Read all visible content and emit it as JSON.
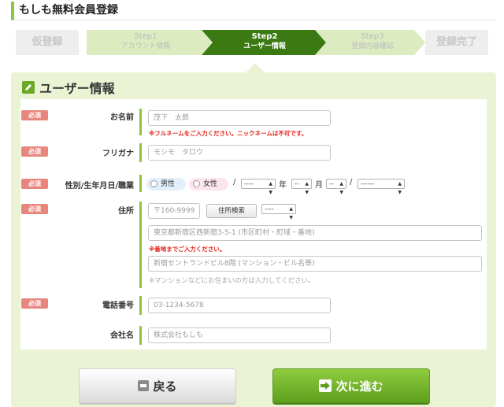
{
  "page_title": "もしも無料会員登録",
  "steps": {
    "first": "仮登録",
    "step1": {
      "num": "Step1",
      "label": "アカウント情報"
    },
    "step2": {
      "num": "Step2",
      "label": "ユーザー情報"
    },
    "step3": {
      "num": "Step3",
      "label": "登録内容確認"
    },
    "last": "登録完了",
    "active_color": "#3b7a12",
    "inactive_color": "#dcebc0"
  },
  "section_title": "ユーザー情報",
  "required_label": "必須",
  "form": {
    "name": {
      "label": "お名前",
      "placeholder": "茂下　太郎",
      "error": "※フルネームをご入力ください。ニックネームは不可です。"
    },
    "furigana": {
      "label": "フリガナ",
      "placeholder": "モシモ　タロウ"
    },
    "profile": {
      "label": "性別/生年月日/職業",
      "male": "男性",
      "female": "女性",
      "slash1": "/",
      "year_value": "----",
      "year_unit": "年",
      "month_value": "--",
      "month_unit": "月",
      "day_value": "--",
      "slash2": "/",
      "job_value": "------"
    },
    "address": {
      "label": "住所",
      "zip_placeholder": "〒160-9999",
      "search_button": "住所検索",
      "pref_value": "----",
      "line1_placeholder": "東京都新宿区西新宿3-5-1 (市区町村・町域・番地)",
      "line1_error": "※番地までご入力ください。",
      "line2_placeholder": "新宿セントランドビル8階 (マンション・ビル名等)",
      "line2_note": "※マンションなどにお住まいの方は入力してください。"
    },
    "phone": {
      "label": "電話番号",
      "placeholder": "03-1234-5678"
    },
    "company": {
      "label": "会社名",
      "placeholder": "株式会社もしも"
    }
  },
  "buttons": {
    "back": "戻る",
    "next": "次に進む"
  }
}
